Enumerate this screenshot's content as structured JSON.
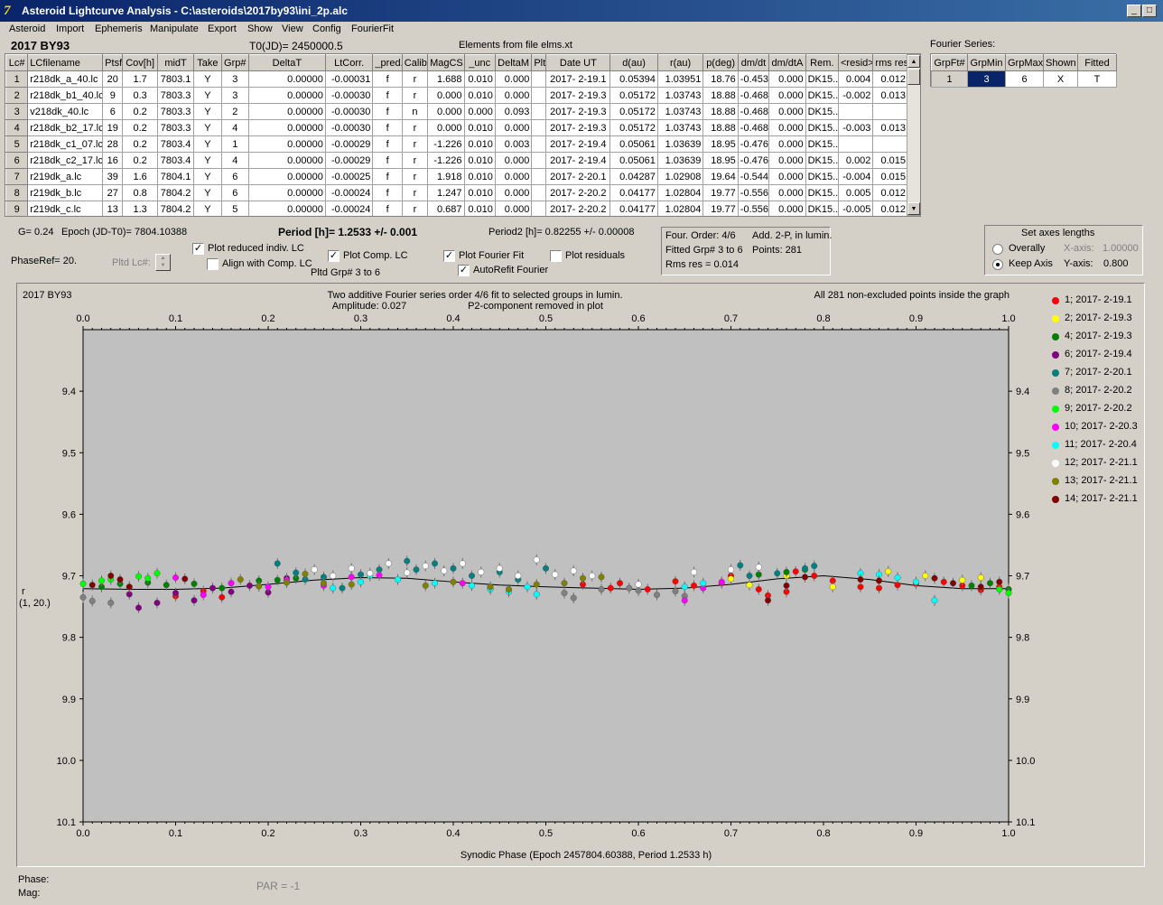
{
  "window": {
    "title": "Asteroid Lightcurve Analysis - C:\\asteroids\\2017by93\\ini_2p.alc",
    "icon_glyph": "7"
  },
  "menu": [
    "Asteroid",
    "Import",
    "Ephemeris",
    "Manipulate",
    "Export",
    "Show",
    "View",
    "Config",
    "FourierFit"
  ],
  "header": {
    "asteroid": "2017 BY93",
    "t0": "T0(JD)= 2450000.5",
    "elements": "Elements from file elms.xt"
  },
  "lc_table": {
    "headers": [
      "Lc#",
      "LCfilename",
      "Ptsf",
      "Cov[h]",
      "midT",
      "Take",
      "Grp#",
      "DeltaT",
      "LtCorr.",
      "_pred.",
      "Calib.",
      "MagCS",
      "_unc",
      "DeltaM",
      "Plt",
      "Date UT",
      "d(au)",
      "r(au)",
      "p(deg)",
      "dm/dt",
      "dm/dtA",
      "Rem.",
      "<resid>",
      "rms res"
    ],
    "rows": [
      [
        "1",
        "r218dk_a_40.lc",
        "20",
        "1.7",
        "7803.1",
        "Y",
        "3",
        "0.00000",
        "-0.00031",
        "f",
        "r",
        "1.688",
        "0.010",
        "0.000",
        "",
        "2017- 2-19.1",
        "0.05394",
        "1.03951",
        "18.76",
        "-0.453",
        "0.000",
        "DK15..",
        "0.004",
        "0.012"
      ],
      [
        "2",
        "r218dk_b1_40.lc",
        "9",
        "0.3",
        "7803.3",
        "Y",
        "3",
        "0.00000",
        "-0.00030",
        "f",
        "r",
        "0.000",
        "0.010",
        "0.000",
        "",
        "2017- 2-19.3",
        "0.05172",
        "1.03743",
        "18.88",
        "-0.468",
        "0.000",
        "DK15..",
        "-0.002",
        "0.013"
      ],
      [
        "3",
        "v218dk_40.lc",
        "6",
        "0.2",
        "7803.3",
        "Y",
        "2",
        "0.00000",
        "-0.00030",
        "f",
        "n",
        "0.000",
        "0.000",
        "0.093",
        "",
        "2017- 2-19.3",
        "0.05172",
        "1.03743",
        "18.88",
        "-0.468",
        "0.000",
        "DK15..",
        "",
        ""
      ],
      [
        "4",
        "r218dk_b2_17.lc",
        "19",
        "0.2",
        "7803.3",
        "Y",
        "4",
        "0.00000",
        "-0.00030",
        "f",
        "r",
        "0.000",
        "0.010",
        "0.000",
        "",
        "2017- 2-19.3",
        "0.05172",
        "1.03743",
        "18.88",
        "-0.468",
        "0.000",
        "DK15..",
        "-0.003",
        "0.013"
      ],
      [
        "5",
        "r218dk_c1_07.lc",
        "28",
        "0.2",
        "7803.4",
        "Y",
        "1",
        "0.00000",
        "-0.00029",
        "f",
        "r",
        "-1.226",
        "0.010",
        "0.003",
        "",
        "2017- 2-19.4",
        "0.05061",
        "1.03639",
        "18.95",
        "-0.476",
        "0.000",
        "DK15..",
        "",
        ""
      ],
      [
        "6",
        "r218dk_c2_17.lc",
        "16",
        "0.2",
        "7803.4",
        "Y",
        "4",
        "0.00000",
        "-0.00029",
        "f",
        "r",
        "-1.226",
        "0.010",
        "0.000",
        "",
        "2017- 2-19.4",
        "0.05061",
        "1.03639",
        "18.95",
        "-0.476",
        "0.000",
        "DK15..",
        "0.002",
        "0.015"
      ],
      [
        "7",
        "r219dk_a.lc",
        "39",
        "1.6",
        "7804.1",
        "Y",
        "6",
        "0.00000",
        "-0.00025",
        "f",
        "r",
        "1.918",
        "0.010",
        "0.000",
        "",
        "2017- 2-20.1",
        "0.04287",
        "1.02908",
        "19.64",
        "-0.544",
        "0.000",
        "DK15..",
        "-0.004",
        "0.015"
      ],
      [
        "8",
        "r219dk_b.lc",
        "27",
        "0.8",
        "7804.2",
        "Y",
        "6",
        "0.00000",
        "-0.00024",
        "f",
        "r",
        "1.247",
        "0.010",
        "0.000",
        "",
        "2017- 2-20.2",
        "0.04177",
        "1.02804",
        "19.77",
        "-0.556",
        "0.000",
        "DK15..",
        "0.005",
        "0.012"
      ],
      [
        "9",
        "r219dk_c.lc",
        "13",
        "1.3",
        "7804.2",
        "Y",
        "5",
        "0.00000",
        "-0.00024",
        "f",
        "r",
        "0.687",
        "0.010",
        "0.000",
        "",
        "2017- 2-20.2",
        "0.04177",
        "1.02804",
        "19.77",
        "-0.556",
        "0.000",
        "DK15..",
        "-0.005",
        "0.012"
      ]
    ]
  },
  "fourier_series": {
    "title": "Fourier Series:",
    "headers": [
      "GrpFt#",
      "GrpMin",
      "GrpMax",
      "Shown",
      "Fitted"
    ],
    "row": [
      "1",
      "3",
      "6",
      "X",
      "T"
    ]
  },
  "info": {
    "g": "G= 0.24",
    "epoch": "Epoch (JD-T0)= 7804.10388",
    "period": "Period [h]= 1.2533 +/- 0.001",
    "period2": "Period2 [h]= 0.82255 +/- 0.00008",
    "phaseref": "PhaseRef= 20.",
    "pltd_lc": "Pltd Lc#:",
    "pltd_grp": "Pltd Grp#  3  to  6"
  },
  "checkboxes": {
    "plot_reduced": {
      "label": "Plot reduced indiv. LC",
      "checked": true
    },
    "align_comp": {
      "label": "Align with Comp. LC",
      "checked": false
    },
    "plot_comp": {
      "label": "Plot Comp. LC",
      "checked": true
    },
    "plot_fourier": {
      "label": "Plot Fourier Fit",
      "checked": true
    },
    "autorefit": {
      "label": "AutoRefit Fourier",
      "checked": true
    },
    "plot_residuals": {
      "label": "Plot residuals",
      "checked": false
    }
  },
  "fit_info": {
    "order": "Four. Order:  4/6",
    "add": "Add. 2-P, in lumin.",
    "fitted": "Fitted Grp# 3 to 6",
    "points": "Points: 281",
    "rms": "Rms res      = 0.014"
  },
  "axes_panel": {
    "title": "Set axes lengths",
    "overally": "Overally",
    "keep_axis": "Keep Axis",
    "selected": "Keep Axis",
    "xaxis_label": "X-axis:",
    "xaxis_value": "1.00000",
    "yaxis_label": "Y-axis:",
    "yaxis_value": "0.800"
  },
  "bottom": {
    "phase": "Phase:",
    "mag": "Mag:",
    "par": "PAR = -1"
  },
  "chart_data": {
    "type": "scatter",
    "name": "2017 BY93",
    "title": "Two additive Fourier series order 4/6 fit to selected groups in lumin.",
    "subtitle_left": "Amplitude: 0.027",
    "subtitle_right": "P2-component removed in plot",
    "note": "All 281 non-excluded points inside the graph",
    "xlabel": "Synodic Phase (Epoch 2457804.60388, Period 1.2533 h)",
    "ylabel": "r\n(1, 20.)",
    "xlim": [
      0.0,
      1.0
    ],
    "ylim": [
      9.3,
      10.1
    ],
    "y_inverted": true,
    "x_ticks": [
      "0.0",
      "0.1",
      "0.2",
      "0.3",
      "0.4",
      "0.5",
      "0.6",
      "0.7",
      "0.8",
      "0.9",
      "1.0"
    ],
    "y_ticks": [
      "9.4",
      "9.5",
      "9.6",
      "9.7",
      "9.8",
      "9.9",
      "10.0",
      "10.1"
    ],
    "background": "#c0c0c0",
    "legend_position": "right",
    "fourier_fit": {
      "x": [
        0.0,
        0.05,
        0.1,
        0.15,
        0.2,
        0.25,
        0.3,
        0.35,
        0.4,
        0.45,
        0.5,
        0.55,
        0.6,
        0.65,
        0.7,
        0.75,
        0.8,
        0.85,
        0.9,
        0.95,
        1.0
      ],
      "y": [
        9.721,
        9.722,
        9.722,
        9.72,
        9.714,
        9.707,
        9.703,
        9.704,
        9.71,
        9.715,
        9.718,
        9.72,
        9.722,
        9.72,
        9.714,
        9.705,
        9.7,
        9.706,
        9.716,
        9.721,
        9.721
      ]
    },
    "series": [
      {
        "name": "1; 2017- 2-19.1",
        "color": "#ff0000",
        "x": [
          0.54,
          0.57,
          0.58,
          0.61,
          0.64,
          0.66,
          0.69,
          0.7,
          0.73,
          0.74,
          0.76,
          0.77,
          0.79,
          0.81,
          0.84,
          0.86,
          0.88,
          0.9,
          0.93,
          0.95,
          0.97,
          0.99,
          1.0,
          0.1,
          0.13,
          0.15
        ],
        "y": [
          9.714,
          9.72,
          9.712,
          9.722,
          9.709,
          9.716,
          9.712,
          9.7,
          9.722,
          9.732,
          9.726,
          9.693,
          9.7,
          9.708,
          9.718,
          9.72,
          9.715,
          9.713,
          9.71,
          9.716,
          9.723,
          9.718,
          9.722,
          9.733,
          9.725,
          9.735
        ]
      },
      {
        "name": "2; 2017- 2-19.3",
        "color": "#ffff00",
        "x": [
          0.7,
          0.72,
          0.76,
          0.81,
          0.87,
          0.91,
          0.95,
          0.97
        ],
        "y": [
          9.705,
          9.715,
          9.7,
          9.718,
          9.693,
          9.7,
          9.707,
          9.703
        ]
      },
      {
        "name": "4; 2017- 2-19.3",
        "color": "#008000",
        "x": [
          0.07,
          0.09,
          0.12,
          0.15,
          0.19,
          0.21,
          0.23,
          0.73,
          0.76,
          0.78,
          0.96,
          0.98,
          1.0,
          0.02,
          0.04
        ],
        "y": [
          9.711,
          9.715,
          9.713,
          9.72,
          9.708,
          9.707,
          9.704,
          9.698,
          9.694,
          9.69,
          9.716,
          9.712,
          9.722,
          9.718,
          9.713
        ]
      },
      {
        "name": "6; 2017- 2-19.4",
        "color": "#800080",
        "x": [
          0.06,
          0.08,
          0.1,
          0.12,
          0.14,
          0.16,
          0.18,
          0.2,
          0.22,
          0.05
        ],
        "y": [
          9.752,
          9.744,
          9.728,
          9.74,
          9.72,
          9.726,
          9.716,
          9.727,
          9.704,
          9.73
        ]
      },
      {
        "name": "7; 2017- 2-20.1",
        "color": "#008080",
        "x": [
          0.21,
          0.23,
          0.24,
          0.26,
          0.28,
          0.3,
          0.32,
          0.35,
          0.36,
          0.38,
          0.4,
          0.42,
          0.45,
          0.47,
          0.5,
          0.71,
          0.72,
          0.75,
          0.78,
          0.79
        ],
        "y": [
          9.68,
          9.695,
          9.706,
          9.702,
          9.72,
          9.698,
          9.69,
          9.676,
          9.69,
          9.68,
          9.688,
          9.7,
          9.694,
          9.706,
          9.688,
          9.683,
          9.7,
          9.696,
          9.688,
          9.684
        ]
      },
      {
        "name": "8; 2017- 2-20.2",
        "color": "#808080",
        "x": [
          0.52,
          0.53,
          0.56,
          0.59,
          0.6,
          0.62,
          0.64,
          0.65,
          0.0,
          0.01,
          0.03
        ],
        "y": [
          9.728,
          9.736,
          9.722,
          9.72,
          9.724,
          9.731,
          9.725,
          9.733,
          9.735,
          9.741,
          9.744
        ]
      },
      {
        "name": "9; 2017- 2-20.2",
        "color": "#00ff00",
        "x": [
          0.0,
          0.02,
          0.03,
          0.05,
          0.06,
          0.07,
          0.08,
          1.0,
          0.99
        ],
        "y": [
          9.713,
          9.708,
          9.706,
          9.718,
          9.701,
          9.704,
          9.696,
          9.728,
          9.722
        ]
      },
      {
        "name": "10; 2017- 2-20.3",
        "color": "#ff00ff",
        "x": [
          0.1,
          0.13,
          0.16,
          0.2,
          0.22,
          0.26,
          0.29,
          0.32,
          0.41,
          0.44,
          0.65,
          0.67,
          0.69
        ],
        "y": [
          9.703,
          9.731,
          9.712,
          9.718,
          9.707,
          9.716,
          9.702,
          9.699,
          9.712,
          9.72,
          9.74,
          9.72,
          9.71
        ]
      },
      {
        "name": "11; 2017- 2-20.4",
        "color": "#00ffff",
        "x": [
          0.27,
          0.3,
          0.31,
          0.34,
          0.38,
          0.42,
          0.44,
          0.46,
          0.48,
          0.49,
          0.65,
          0.67,
          0.84,
          0.86,
          0.88,
          0.9,
          0.92
        ],
        "y": [
          9.72,
          9.71,
          9.7,
          9.706,
          9.712,
          9.716,
          9.722,
          9.726,
          9.718,
          9.73,
          9.718,
          9.712,
          9.696,
          9.698,
          9.703,
          9.71,
          9.74
        ]
      },
      {
        "name": "12; 2017- 2-21.1",
        "color": "#ffffff",
        "x": [
          0.25,
          0.27,
          0.29,
          0.31,
          0.33,
          0.35,
          0.37,
          0.39,
          0.41,
          0.43,
          0.45,
          0.47,
          0.49,
          0.51,
          0.53,
          0.55,
          0.6,
          0.66,
          0.7,
          0.73
        ],
        "y": [
          9.69,
          9.7,
          9.688,
          9.696,
          9.68,
          9.695,
          9.684,
          9.692,
          9.68,
          9.694,
          9.688,
          9.7,
          9.674,
          9.698,
          9.692,
          9.7,
          9.714,
          9.694,
          9.69,
          9.686
        ]
      },
      {
        "name": "13; 2017- 2-21.1",
        "color": "#808000",
        "x": [
          0.17,
          0.19,
          0.22,
          0.24,
          0.26,
          0.29,
          0.37,
          0.4,
          0.44,
          0.46,
          0.49,
          0.52,
          0.54,
          0.56
        ],
        "y": [
          9.706,
          9.717,
          9.711,
          9.697,
          9.712,
          9.714,
          9.716,
          9.71,
          9.718,
          9.722,
          9.714,
          9.712,
          9.704,
          9.702
        ]
      },
      {
        "name": "14; 2017- 2-21.1",
        "color": "#800000",
        "x": [
          0.01,
          0.03,
          0.04,
          0.05,
          0.11,
          0.74,
          0.76,
          0.78,
          0.84,
          0.86,
          0.92,
          0.94,
          0.97,
          0.99
        ],
        "y": [
          9.715,
          9.7,
          9.706,
          9.718,
          9.705,
          9.74,
          9.716,
          9.702,
          9.706,
          9.708,
          9.704,
          9.712,
          9.718,
          9.71
        ]
      }
    ]
  }
}
